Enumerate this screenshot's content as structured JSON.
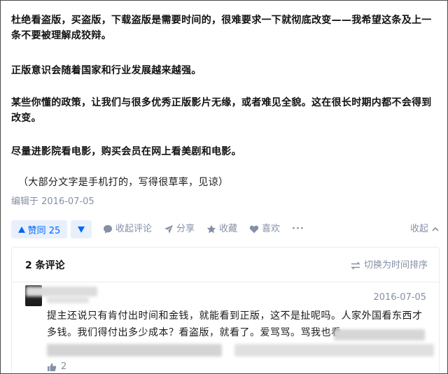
{
  "answer": {
    "paragraphs": [
      "杜绝看盗版，买盗版，下载盗版是需要时间的，很难要求一下就彻底改变——我希望这条及上一条不要被理解成狡辩。",
      "正版意识会随着国家和行业发展越来越强。",
      "某些你懂的政策，让我们与很多优秀正版影片无缘，或者难见全貌。这在很长时期内都不会得到改变。",
      "尽量进影院看电影，购买会员在网上看美剧和电影。"
    ],
    "note": "（大部分文字是手机打的，写得很草率，见谅）",
    "edited": "编辑于 2016-07-05"
  },
  "actions": {
    "vote_up": "赞同 25",
    "comment": "收起评论",
    "share": "分享",
    "favorite": "收藏",
    "like": "喜欢",
    "more": "···",
    "collapse": "收起"
  },
  "comments": {
    "count": "2 条评论",
    "sort": "切换为时间排序",
    "items": [
      {
        "date": "2016-07-05",
        "text": "提主还说只有肯付出时间和金钱，就能看到正版，这不是扯呢吗。人家外国看东西才多钱。我们得付出多少成本？看盗版，就看了。爱骂骂。骂我也看",
        "likes": "2"
      }
    ]
  },
  "colors": {
    "accent": "#0066ff",
    "accent_bg": "#e8f0fc",
    "muted": "#8590a6",
    "border": "#ebebeb"
  }
}
